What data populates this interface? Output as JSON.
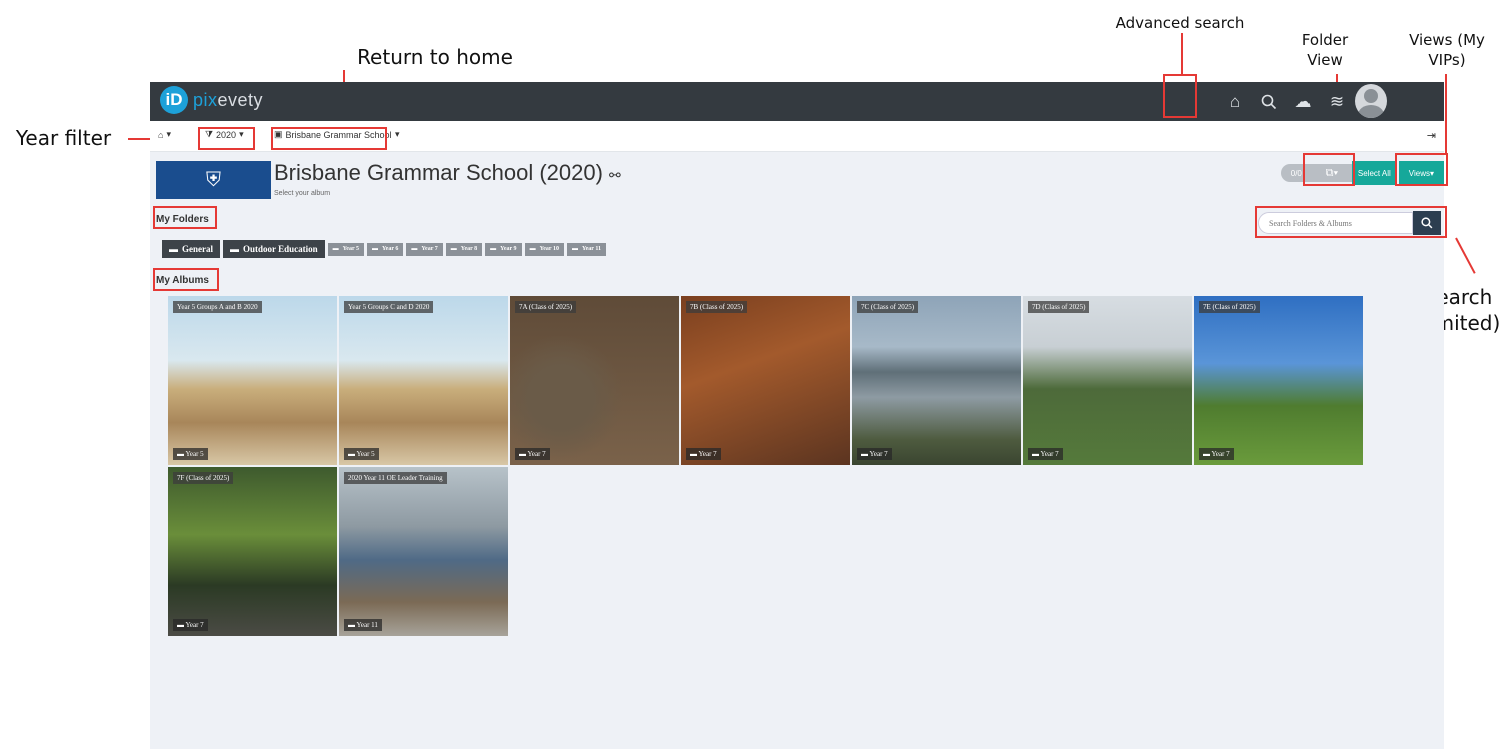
{
  "annotations": {
    "advanced_search": "Advanced search",
    "return_home": "Return to home",
    "folder_view": "Folder View",
    "views": "Views (My VIPs)",
    "year_filter": "Year filter",
    "search_limited": "Search (limited)"
  },
  "brand": {
    "logo_letter": "iD",
    "name_prefix": "pix",
    "name_suffix": "evety"
  },
  "topbar": {
    "icons": [
      "home-icon",
      "search-icon",
      "cloud-upload-icon",
      "layers-icon",
      "bell-icon",
      "avatar-icon"
    ]
  },
  "breadcrumb": {
    "year": "2020",
    "school": "Brisbane Grammar School"
  },
  "header": {
    "title": "Brisbane Grammar School (2020)",
    "subtitle": "Select your album",
    "count": "0/0",
    "select_all": "Select All",
    "views": "Views"
  },
  "folders": {
    "heading": "My Folders",
    "large": [
      "General",
      "Outdoor Education"
    ],
    "small": [
      "Year 5",
      "Year 6",
      "Year 7",
      "Year 8",
      "Year 9",
      "Year 10",
      "Year 11"
    ]
  },
  "search": {
    "placeholder": "Search Folders & Albums"
  },
  "albums": {
    "heading": "My Albums",
    "items": [
      {
        "title": "Year 5 Groups A and B 2020",
        "folder": "Year 5",
        "theme": "dunes"
      },
      {
        "title": "Year 5 Groups C and D 2020",
        "folder": "Year 5",
        "theme": "dunes"
      },
      {
        "title": "7A (Class of 2025)",
        "folder": "Year 7",
        "theme": "forest"
      },
      {
        "title": "7B (Class of 2025)",
        "folder": "Year 7",
        "theme": "climb"
      },
      {
        "title": "7C (Class of 2025)",
        "folder": "Year 7",
        "theme": "lake"
      },
      {
        "title": "7D (Class of 2025)",
        "folder": "Year 7",
        "theme": "field"
      },
      {
        "title": "7E (Class of 2025)",
        "folder": "Year 7",
        "theme": "sky"
      },
      {
        "title": "7F (Class of 2025)",
        "folder": "Year 7",
        "theme": "trees"
      },
      {
        "title": "2020 Year 11 OE Leader Training",
        "folder": "Year 11",
        "theme": "class"
      }
    ]
  },
  "colors": {
    "accent": "#16a89a",
    "topbar": "#343a40",
    "annotation": "#e53935"
  }
}
